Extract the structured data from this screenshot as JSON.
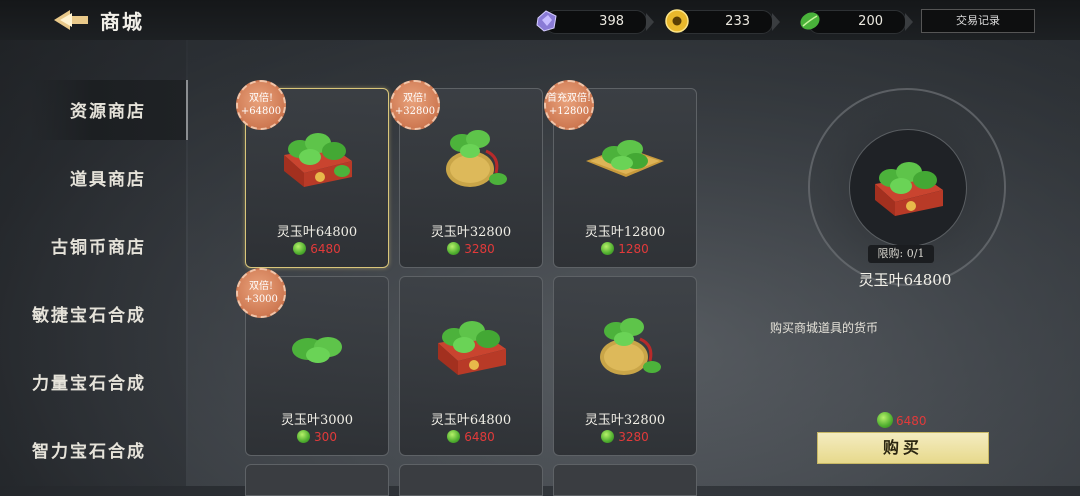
{
  "header": {
    "title": "商城"
  },
  "currencies": [
    {
      "icon": "purple-gem-icon",
      "value": "398"
    },
    {
      "icon": "gold-coin-icon",
      "value": "233"
    },
    {
      "icon": "jade-leaf-icon",
      "value": "200"
    }
  ],
  "trade_record_label": "交易记录",
  "sidebar": {
    "items": [
      {
        "label": "资源商店"
      },
      {
        "label": "道具商店"
      },
      {
        "label": "古铜币商店"
      },
      {
        "label": "敏捷宝石合成"
      },
      {
        "label": "力量宝石合成"
      },
      {
        "label": "智力宝石合成"
      }
    ]
  },
  "products": [
    {
      "name": "灵玉叶64800",
      "price": "6480",
      "badge_line1": "双倍!",
      "badge_line2": "+64800",
      "art": "box"
    },
    {
      "name": "灵玉叶32800",
      "price": "3280",
      "badge_line1": "双倍!",
      "badge_line2": "+32800",
      "art": "bag"
    },
    {
      "name": "灵玉叶12800",
      "price": "1280",
      "badge_line1": "首充双倍!",
      "badge_line2": "+12800",
      "art": "mat"
    },
    {
      "name": "灵玉叶3000",
      "price": "300",
      "badge_line1": "双倍!",
      "badge_line2": "+3000",
      "art": "leaf"
    },
    {
      "name": "灵玉叶64800",
      "price": "6480",
      "art": "box"
    },
    {
      "name": "灵玉叶32800",
      "price": "3280",
      "art": "bag"
    }
  ],
  "detail": {
    "limit": "限购: 0/1",
    "name": "灵玉叶64800",
    "description": "购买商城道具的货币",
    "price": "6480",
    "buy_label": "购买"
  },
  "colors": {
    "price_red": "#e23a3a",
    "buy_button": "#e9dc93",
    "selected_border": "#d9c67a"
  }
}
